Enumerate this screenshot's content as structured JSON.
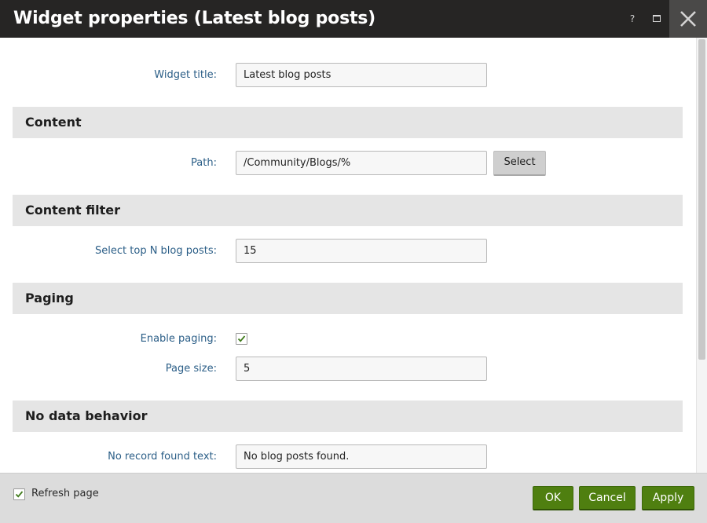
{
  "window": {
    "title": "Widget properties (Latest blog posts)",
    "help_icon": "?",
    "maximize_icon": "maximize-icon",
    "close_icon": "close-icon"
  },
  "fields": {
    "widget_title": {
      "label": "Widget title:",
      "value": "Latest blog posts"
    },
    "path": {
      "label": "Path:",
      "value": "/Community/Blogs/%",
      "button": "Select"
    },
    "top_n": {
      "label": "Select top N blog posts:",
      "value": "15"
    },
    "enable_paging": {
      "label": "Enable paging:",
      "checked": true
    },
    "page_size": {
      "label": "Page size:",
      "value": "5"
    },
    "no_record_text": {
      "label": "No record found text:",
      "value": "No blog posts found."
    }
  },
  "sections": {
    "content": "Content",
    "content_filter": "Content filter",
    "paging": "Paging",
    "no_data_behavior": "No data behavior"
  },
  "footer": {
    "refresh_label": "Refresh page",
    "refresh_checked": true,
    "ok": "OK",
    "cancel": "Cancel",
    "apply": "Apply"
  },
  "colors": {
    "titlebar": "#262524",
    "label_blue": "#2b5e87",
    "section_bg": "#e5e5e5",
    "primary_green": "#4f7f10"
  }
}
